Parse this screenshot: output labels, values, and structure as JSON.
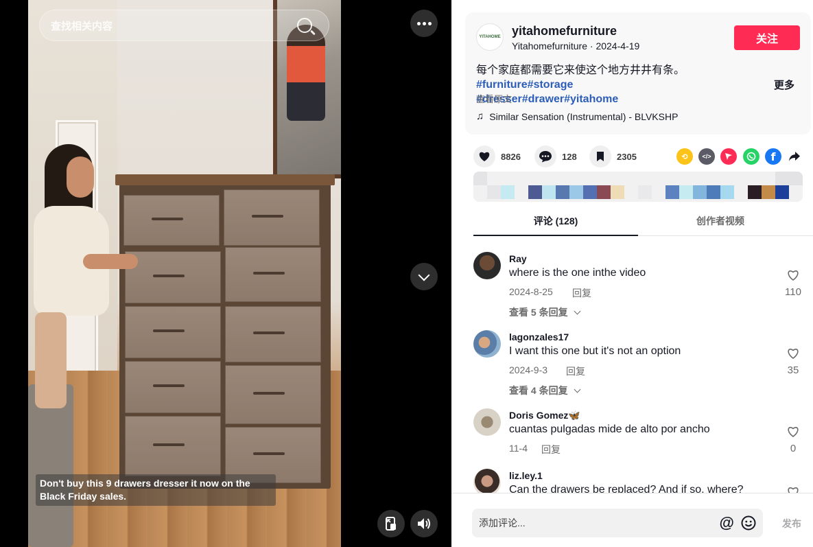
{
  "search": {
    "placeholder": "查找相关内容"
  },
  "video": {
    "caption": "Don't buy this 9 drawers dresser it now on the Black Friday sales."
  },
  "author": {
    "username": "yitahomefurniture",
    "nickname": "Yitahomefurniture",
    "date": "2024-4-19",
    "meta_separator": " · ",
    "avatar_text": "YITAHOME",
    "follow_label": "关注"
  },
  "description": {
    "text": "每个家庭都需要它来使这个地方井井有条。",
    "hashtags": [
      "#furniture",
      "#storage",
      "#dresser",
      "#drawer",
      "#yitahome"
    ],
    "more_label": "更多",
    "original_label": "查看原文"
  },
  "music": {
    "title": "Similar Sensation (Instrumental) - BLVKSHP"
  },
  "stats": {
    "likes": "8826",
    "comments": "128",
    "favorites": "2305"
  },
  "share_icons": [
    "repost-icon",
    "embed-icon",
    "send-icon",
    "whatsapp-icon",
    "facebook-icon",
    "share-arrow-icon"
  ],
  "colors": {
    "brand": "#fe2c55",
    "hashtag": "#2b5db9",
    "repost": "#fcc419",
    "embed": "#5b5b66",
    "send": "#fe2c55",
    "whatsapp": "#25d366",
    "facebook": "#1877f2"
  },
  "tabs": [
    {
      "label": "评论 (128)",
      "active": true
    },
    {
      "label": "创作者视频",
      "active": false
    }
  ],
  "comments": [
    {
      "name": "Ray",
      "text": "where is the one inthe video",
      "date": "2024-8-25",
      "reply": "回复",
      "view_replies": "查看 5 条回复",
      "likes": "110"
    },
    {
      "name": "lagonzales17",
      "text": "I want this one but it's not an option",
      "date": "2024-9-3",
      "reply": "回复",
      "view_replies": "查看 4 条回复",
      "likes": "35"
    },
    {
      "name": "Doris Gomez🦋",
      "text": "cuantas pulgadas mide de alto por ancho",
      "date": "11-4",
      "reply": "回复",
      "likes": "0"
    },
    {
      "name": "liz.ley.1",
      "text": "Can the drawers be replaced? And if so, where?",
      "date": "",
      "reply": "",
      "likes": ""
    }
  ],
  "footer": {
    "placeholder": "添加评论...",
    "post_label": "发布"
  }
}
